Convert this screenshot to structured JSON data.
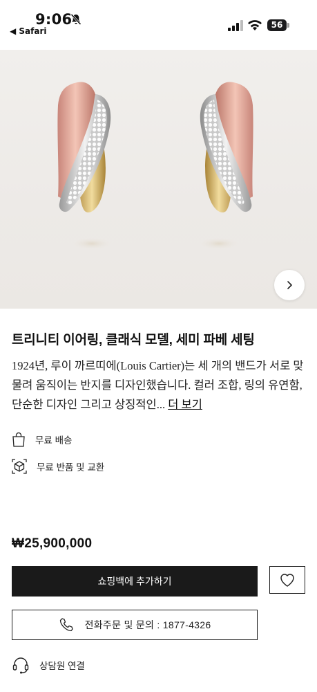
{
  "status_bar": {
    "time": "9:06",
    "back_app": "◀ Safari",
    "battery": "56"
  },
  "hero": {
    "image_icon": "earrings-product-photo",
    "next_icon": "chevron-right-icon"
  },
  "product": {
    "title": "트리니티 이어링, 클래식 모델, 세미 파베 세팅",
    "description": "1924년, 루이 까르띠에(Louis Cartier)는 세 개의 밴드가 서로 맞물려 움직이는 반지를 디자인했습니다. 컬러 조합, 링의 유연함, 단순한 디자인 그리고 상징적인...",
    "more_label": "더 보기",
    "price": "₩25,900,000"
  },
  "features": {
    "free_shipping": "무료 배송",
    "free_returns": "무료 반품 및 교환"
  },
  "actions": {
    "add_to_bag": "쇼핑백에 추가하기",
    "wishlist_icon": "heart-icon",
    "call": "전화주문 및 문의 : 1877-4326",
    "consult": "상담원 연결"
  }
}
